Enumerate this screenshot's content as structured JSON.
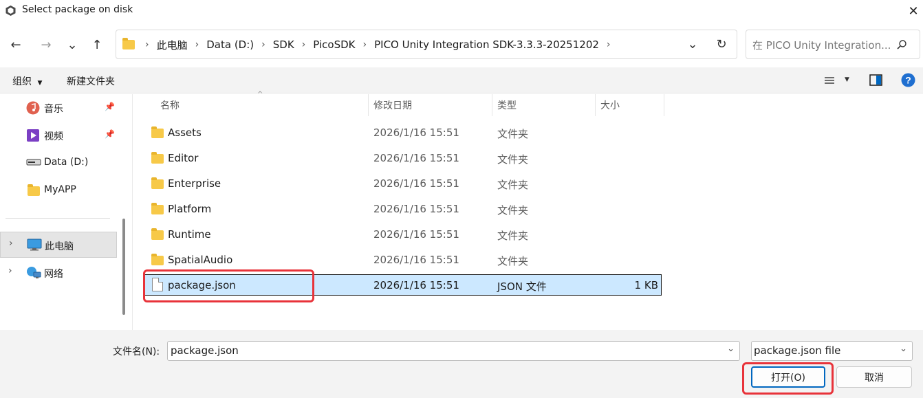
{
  "window": {
    "title": "Select package on disk",
    "close_icon": "✕"
  },
  "nav": {
    "back_icon": "←",
    "forward_icon": "→",
    "recent_icon": "⌄",
    "up_icon": "↑"
  },
  "address": {
    "crumbs": [
      "此电脑",
      "Data (D:)",
      "SDK",
      "PicoSDK",
      "PICO Unity Integration SDK-3.3.3-20251202"
    ],
    "dropdown_icon": "⌄",
    "refresh_icon": "↻"
  },
  "search": {
    "placeholder": "在 PICO Unity Integration..."
  },
  "toolbar": {
    "organize_label": "组织",
    "new_folder_label": "新建文件夹"
  },
  "sidebar": {
    "items": [
      {
        "label": "音乐",
        "icon": "music-icon",
        "pinned": true
      },
      {
        "label": "视频",
        "icon": "video-icon",
        "pinned": true
      },
      {
        "label": "Data (D:)",
        "icon": "drive-icon",
        "pinned": false
      },
      {
        "label": "MyAPP",
        "icon": "folder-icon",
        "pinned": false
      },
      {
        "label": "此电脑",
        "icon": "computer-icon",
        "selected": true
      },
      {
        "label": "网络",
        "icon": "network-icon"
      }
    ]
  },
  "columns": {
    "name": "名称",
    "date": "修改日期",
    "type": "类型",
    "size": "大小"
  },
  "files": [
    {
      "name": "Assets",
      "date": "2026/1/16 15:51",
      "type": "文件夹",
      "size": ""
    },
    {
      "name": "Editor",
      "date": "2026/1/16 15:51",
      "type": "文件夹",
      "size": ""
    },
    {
      "name": "Enterprise",
      "date": "2026/1/16 15:51",
      "type": "文件夹",
      "size": ""
    },
    {
      "name": "Platform",
      "date": "2026/1/16 15:51",
      "type": "文件夹",
      "size": ""
    },
    {
      "name": "Runtime",
      "date": "2026/1/16 15:51",
      "type": "文件夹",
      "size": ""
    },
    {
      "name": "SpatialAudio",
      "date": "2026/1/16 15:51",
      "type": "文件夹",
      "size": ""
    },
    {
      "name": "package.json",
      "date": "2026/1/16 15:51",
      "type": "JSON 文件",
      "size": "1 KB"
    }
  ],
  "footer": {
    "filename_label": "文件名(N):",
    "filename_value": "package.json",
    "filetype_value": "package.json file",
    "open_label": "打开(O)",
    "cancel_label": "取消"
  },
  "colors": {
    "selection_bg": "#cce8ff",
    "accent": "#0067c0",
    "highlight_red": "#e8333a",
    "folder_yellow": "#f7c948"
  }
}
